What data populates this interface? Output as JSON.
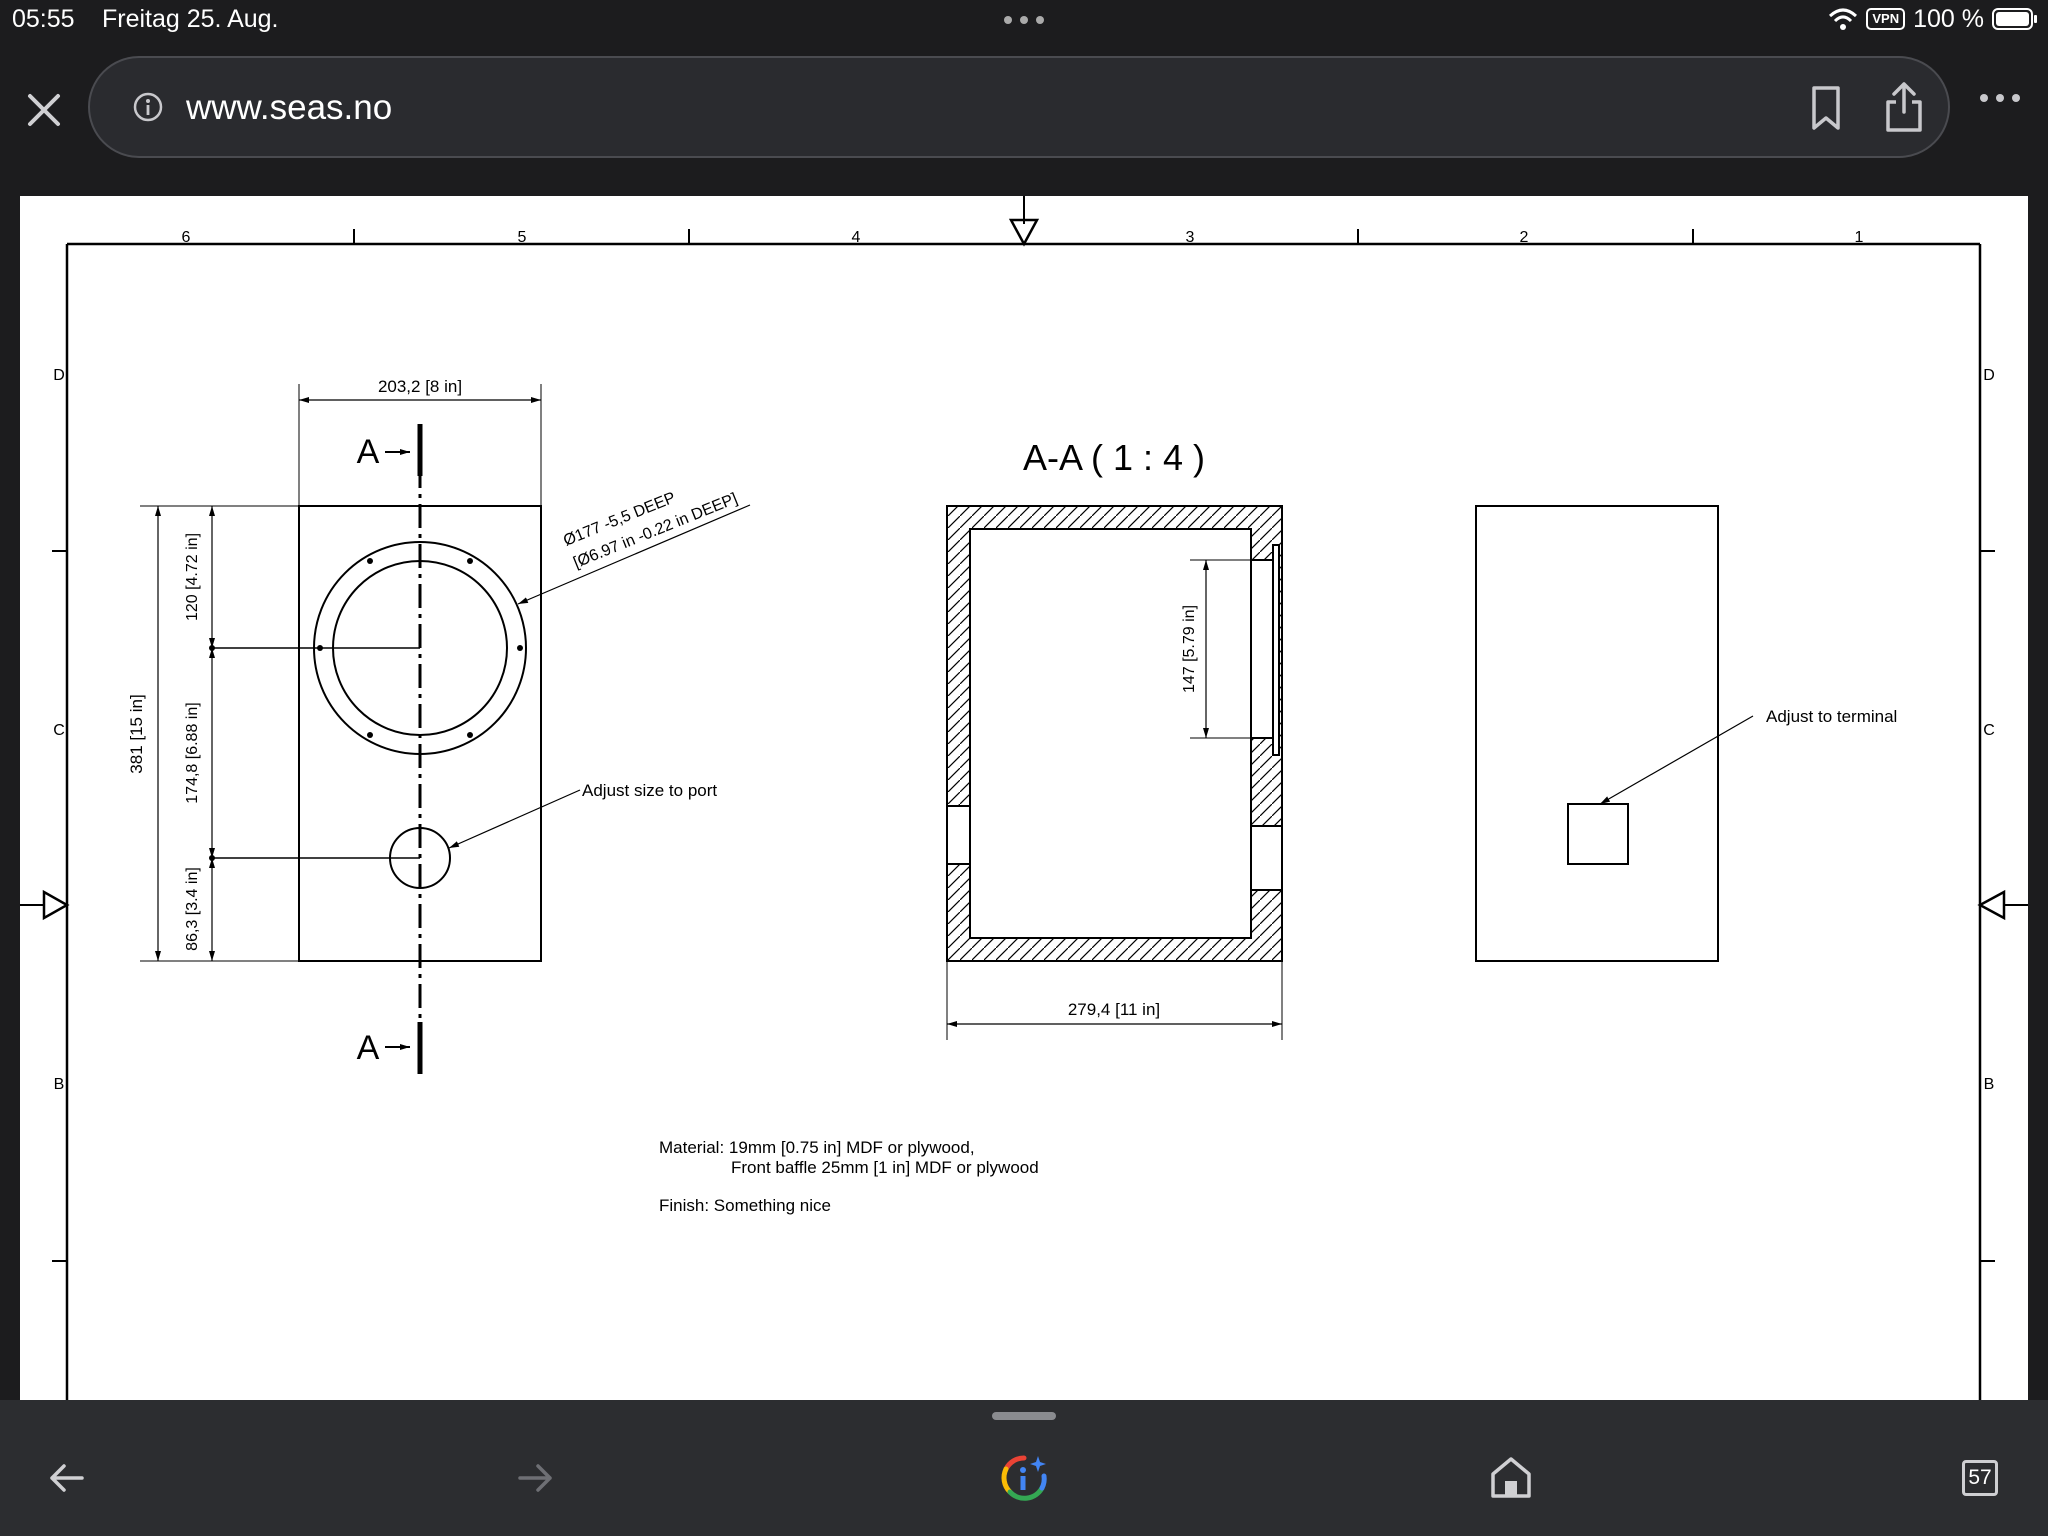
{
  "status_bar": {
    "time": "05:55",
    "date": "Freitag 25. Aug.",
    "vpn": "VPN",
    "battery": "100 %"
  },
  "browser": {
    "url": "www.seas.no"
  },
  "drawing": {
    "frame": {
      "columns": [
        "6",
        "5",
        "4",
        "3",
        "2",
        "1"
      ],
      "rows": [
        "D",
        "C",
        "B"
      ]
    },
    "front_view": {
      "width_dim": "203,2 [8 in]",
      "height_dim": "381 [15 in]",
      "dim_top": "120 [4.72 in]",
      "dim_mid": "174,8 [6.88 in]",
      "dim_bottom": "86,3 [3.4 in]",
      "section_mark": "A",
      "cutout_note_1": "Ø177 -5,5 DEEP",
      "cutout_note_2": "[Ø6.97 in -0.22 in DEEP]",
      "port_note": "Adjust size to port"
    },
    "section_view": {
      "title": "A-A ( 1 : 4 )",
      "depth_dim": "279,4 [11 in]",
      "recess_dim": "147 [5.79 in]"
    },
    "rear_view": {
      "terminal_note": "Adjust to terminal"
    },
    "notes": {
      "material_1": "Material: 19mm [0.75 in] MDF or plywood,",
      "material_2": "Front baffle 25mm [1 in] MDF or plywood",
      "finish": "Finish: Something nice"
    }
  },
  "bottom_bar": {
    "tab_count": "57"
  },
  "colors": {
    "chrome_bg": "#1c1c1e",
    "url_pill": "#2a2b2f",
    "bottom_bar": "#2c2d30",
    "paper": "#ffffff",
    "ink": "#000000"
  }
}
